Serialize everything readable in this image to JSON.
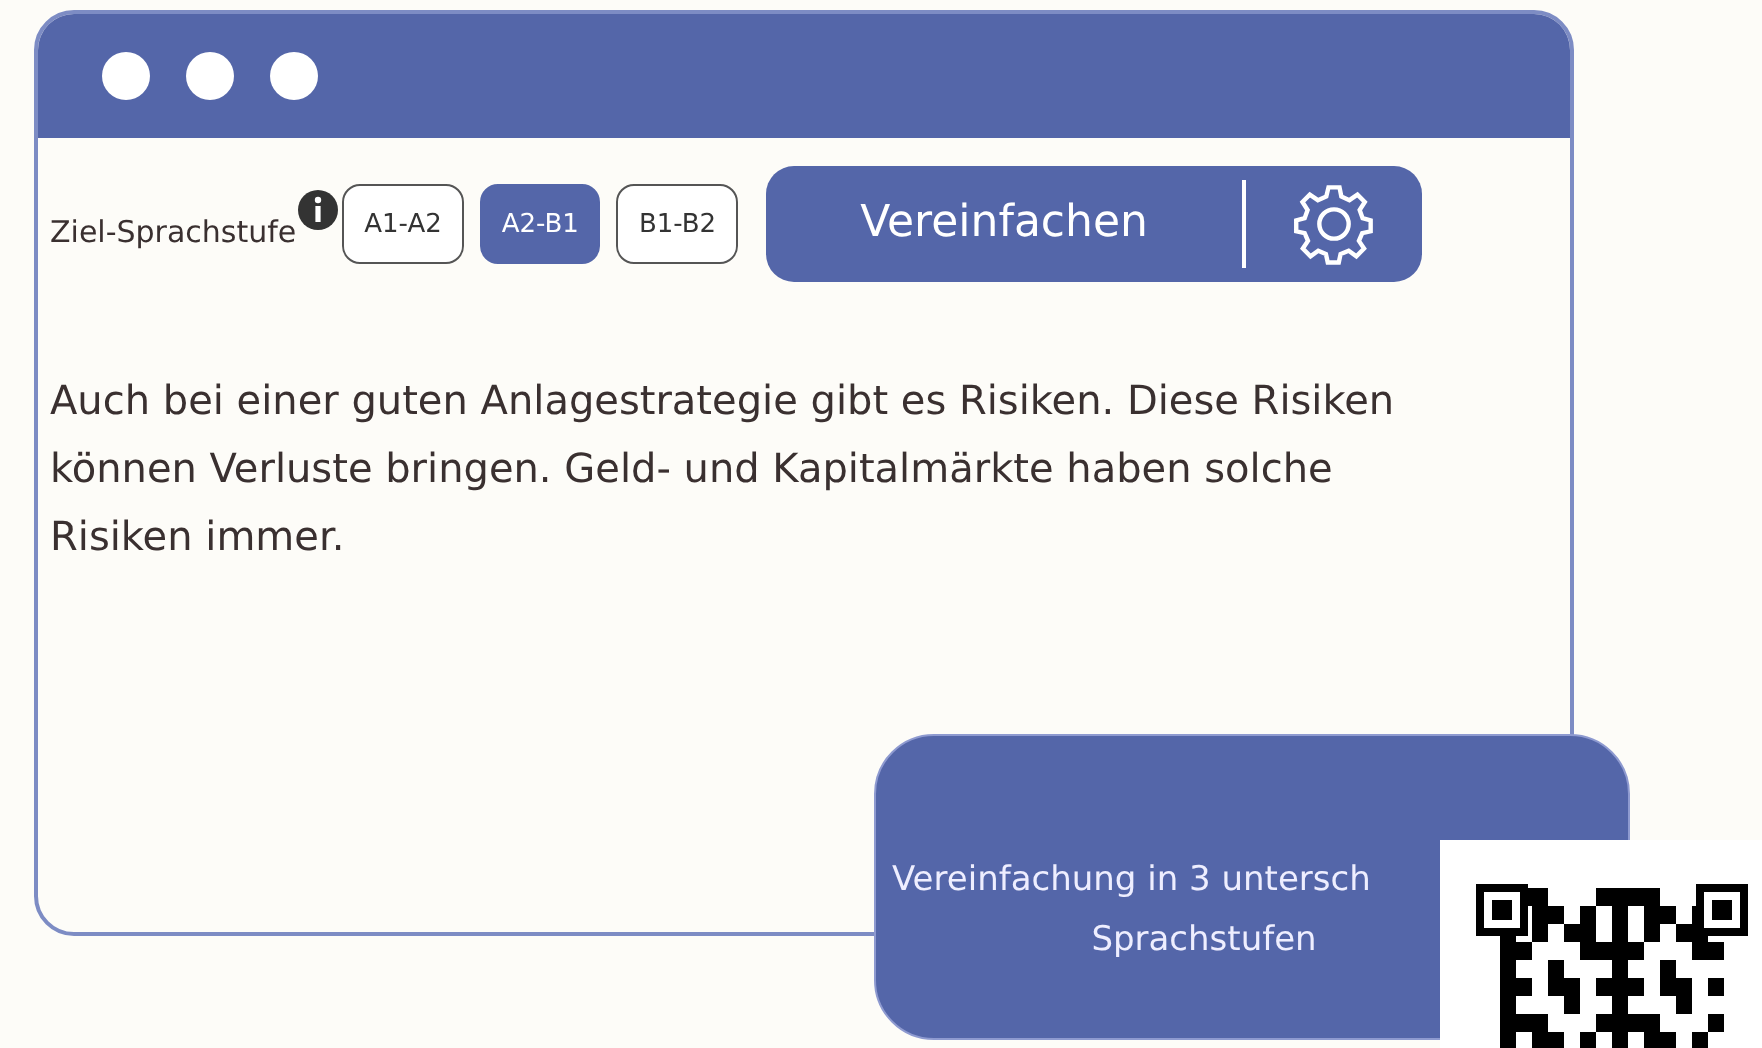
{
  "level_picker": {
    "label": "Ziel-Sprachstufe",
    "levels": [
      {
        "label": "A1-A2",
        "selected": false
      },
      {
        "label": "A2-B1",
        "selected": true
      },
      {
        "label": "B1-B2",
        "selected": false
      }
    ]
  },
  "simplify_button": {
    "label": "Vereinfachen"
  },
  "body_text": "Auch bei einer guten Anlagestrategie gibt es Risiken. Diese Risiken können Verluste bringen. Geld- und Kapitalmärkte haben solche Risiken immer.",
  "callout": {
    "lines": [
      "Vereinfachung in 3 untersch",
      "Sprachstufen"
    ]
  }
}
